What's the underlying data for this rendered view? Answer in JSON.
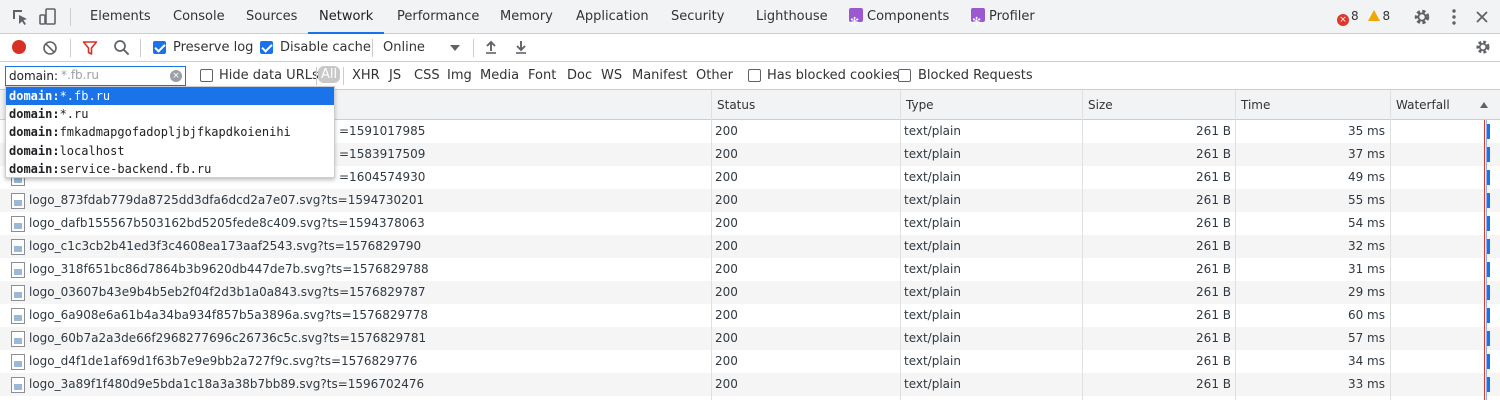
{
  "tabs": [
    {
      "label": "Elements",
      "active": false
    },
    {
      "label": "Console",
      "active": false
    },
    {
      "label": "Sources",
      "active": false
    },
    {
      "label": "Network",
      "active": true
    },
    {
      "label": "Performance",
      "active": false
    },
    {
      "label": "Memory",
      "active": false
    },
    {
      "label": "Application",
      "active": false
    },
    {
      "label": "Security",
      "active": false
    },
    {
      "label": "Lighthouse",
      "active": false
    },
    {
      "label": "Components",
      "active": false
    },
    {
      "label": "Profiler",
      "active": false
    }
  ],
  "badges": {
    "errors": "8",
    "warnings": "8"
  },
  "toolbar": {
    "preserve_log": "Preserve log",
    "disable_cache": "Disable cache",
    "throttling": "Online"
  },
  "filter": {
    "prefix": "domain:",
    "placeholder": "*.fb.ru",
    "hide_data_urls": "Hide data URLs",
    "types": [
      "All",
      "XHR",
      "JS",
      "CSS",
      "Img",
      "Media",
      "Font",
      "Doc",
      "WS",
      "Manifest",
      "Other"
    ],
    "has_blocked_cookies": "Has blocked cookies",
    "blocked_requests": "Blocked Requests"
  },
  "suggestions": [
    {
      "key": "domain:",
      "value": "*.fb.ru"
    },
    {
      "key": "domain:",
      "value": "*.ru"
    },
    {
      "key": "domain:",
      "value": "fmkadmapgofadopljbjfkapdkoienihi"
    },
    {
      "key": "domain:",
      "value": "localhost"
    },
    {
      "key": "domain:",
      "value": "service-backend.fb.ru"
    }
  ],
  "columns": {
    "status": "Status",
    "type": "Type",
    "size": "Size",
    "time": "Time",
    "waterfall": "Waterfall"
  },
  "rows": [
    {
      "name": "",
      "tail": "=1591017985",
      "status": "200",
      "type": "text/plain",
      "size": "261 B",
      "time": "35 ms"
    },
    {
      "name": "",
      "tail": "=1583917509",
      "status": "200",
      "type": "text/plain",
      "size": "261 B",
      "time": "37 ms"
    },
    {
      "name": "",
      "tail": "=1604574930",
      "status": "200",
      "type": "text/plain",
      "size": "261 B",
      "time": "49 ms"
    },
    {
      "name": "logo_873fdab779da8725dd3dfa6dcd2a7e07.svg?ts=1594730201",
      "tail": "",
      "status": "200",
      "type": "text/plain",
      "size": "261 B",
      "time": "55 ms"
    },
    {
      "name": "logo_dafb155567b503162bd5205fede8c409.svg?ts=1594378063",
      "tail": "",
      "status": "200",
      "type": "text/plain",
      "size": "261 B",
      "time": "54 ms"
    },
    {
      "name": "logo_c1c3cb2b41ed3f3c4608ea173aaf2543.svg?ts=1576829790",
      "tail": "",
      "status": "200",
      "type": "text/plain",
      "size": "261 B",
      "time": "32 ms"
    },
    {
      "name": "logo_318f651bc86d7864b3b9620db447de7b.svg?ts=1576829788",
      "tail": "",
      "status": "200",
      "type": "text/plain",
      "size": "261 B",
      "time": "31 ms"
    },
    {
      "name": "logo_03607b43e9b4b5eb2f04f2d3b1a0a843.svg?ts=1576829787",
      "tail": "",
      "status": "200",
      "type": "text/plain",
      "size": "261 B",
      "time": "29 ms"
    },
    {
      "name": "logo_6a908e6a61b4a34ba934f857b5a3896a.svg?ts=1576829778",
      "tail": "",
      "status": "200",
      "type": "text/plain",
      "size": "261 B",
      "time": "60 ms"
    },
    {
      "name": "logo_60b7a2a3de66f2968277696c26736c5c.svg?ts=1576829781",
      "tail": "",
      "status": "200",
      "type": "text/plain",
      "size": "261 B",
      "time": "57 ms"
    },
    {
      "name": "logo_d4f1de1af69d1f63b7e9e9bb2a727f9c.svg?ts=1576829776",
      "tail": "",
      "status": "200",
      "type": "text/plain",
      "size": "261 B",
      "time": "34 ms"
    },
    {
      "name": "logo_3a89f1f480d9e5bda1c18a3a38b7bb89.svg?ts=1596702476",
      "tail": "",
      "status": "200",
      "type": "text/plain",
      "size": "261 B",
      "time": "33 ms"
    }
  ]
}
